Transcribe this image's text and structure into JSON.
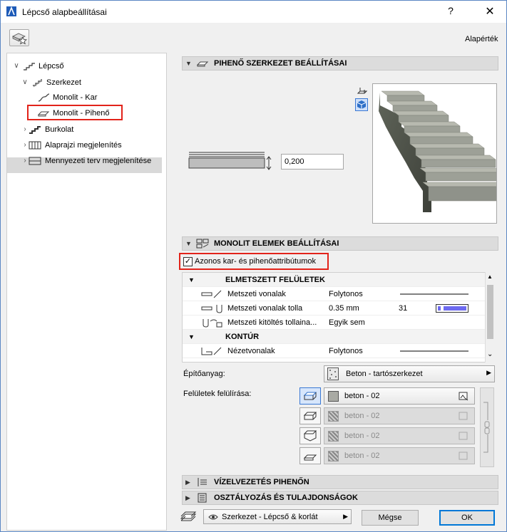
{
  "window": {
    "title": "Lépcső alapbeállításai",
    "help": "?",
    "close": "✕",
    "defaults_label": "Alapérték"
  },
  "tree": [
    {
      "label": "Lépcső"
    },
    {
      "label": "Szerkezet"
    },
    {
      "label": "Monolit - Kar"
    },
    {
      "label": "Monolit - Pihenő"
    },
    {
      "label": "Burkolat"
    },
    {
      "label": "Alaprajzi megjelenítés"
    },
    {
      "label": "Mennyezeti terv megjelenítése"
    }
  ],
  "section_landing": {
    "title": "PIHENŐ SZERKEZET BEÁLLÍTÁSAI",
    "thickness": "0,200"
  },
  "section_monolit": {
    "title": "MONOLIT ELEMEK BEÁLLÍTÁSAI"
  },
  "same_attributes": {
    "label": "Azonos kar- és pihenőattribútumok",
    "checked": true
  },
  "attr_list": {
    "group1": "ELMETSZETT FELÜLETEK",
    "rows1": [
      {
        "name": "Metszeti vonalak",
        "value": "Folytonos",
        "extra": ""
      },
      {
        "name": "Metszeti vonalak tolla",
        "value": "0.35 mm",
        "extra": "31"
      },
      {
        "name": "Metszeti kitöltés tollaina...",
        "value": "Egyik sem",
        "extra": ""
      }
    ],
    "group2": "KONTÚR",
    "rows2": [
      {
        "name": "Nézetvonalak",
        "value": "Folytonos",
        "extra": ""
      }
    ]
  },
  "building_material": {
    "label": "Építőanyag:",
    "value": "Beton - tartószerkezet"
  },
  "surface_override": {
    "label": "Felületek felülírása:",
    "items": [
      "beton - 02",
      "beton - 02",
      "beton - 02",
      "beton - 02"
    ]
  },
  "section_drainage": {
    "title": "VÍZELVEZETÉS PIHENŐN"
  },
  "section_classification": {
    "title": "OSZTÁLYOZÁS ÉS TULAJDONSÁGOK"
  },
  "layer": {
    "value": "Szerkezet - Lépcső & korlát"
  },
  "buttons": {
    "cancel": "Mégse",
    "ok": "OK"
  },
  "colors": {
    "selection_outline": "#e2231a",
    "accent": "#0078d7",
    "pen_color": "#6d6af0"
  }
}
